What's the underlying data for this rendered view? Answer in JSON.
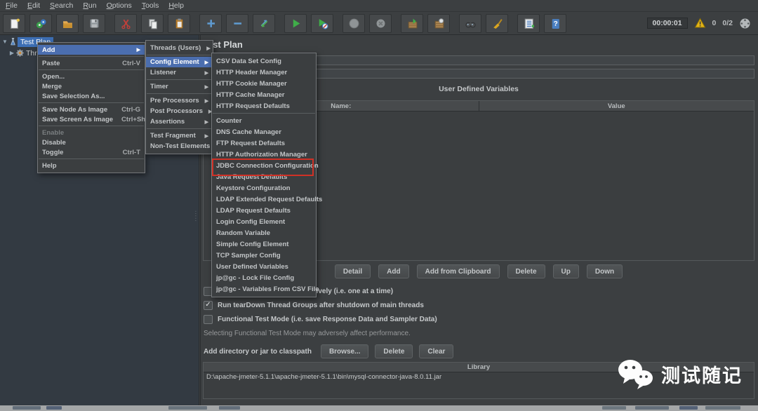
{
  "menubar": {
    "items": [
      "File",
      "Edit",
      "Search",
      "Run",
      "Options",
      "Tools",
      "Help"
    ]
  },
  "toolbar": {
    "icons": [
      "new-file-icon",
      "templates-icon",
      "open-folder-icon",
      "save-icon",
      "cut-icon",
      "copy-icon",
      "paste-icon",
      "add-icon",
      "remove-icon",
      "toggle-arrows-icon",
      "start-icon",
      "start-no-timers-icon",
      "stop-icon",
      "shutdown-icon",
      "remote-start-icon",
      "remote-stop-icon",
      "search-icon",
      "clear-all-icon",
      "function-helper-icon",
      "help-icon",
      "warning-icon",
      "status-circle-icon"
    ],
    "timer": "00:00:01",
    "warning_count": "0",
    "thread_status": "0/2"
  },
  "tree": {
    "items": [
      {
        "label": "Test Plan",
        "selected": true
      },
      {
        "label": "Thre",
        "selected": false
      }
    ]
  },
  "main": {
    "title": "Test Plan",
    "udv_title": "User Defined Variables",
    "columns": [
      "Name:",
      "Value"
    ],
    "table_buttons": [
      "Detail",
      "Add",
      "Add from Clipboard",
      "Delete",
      "Up",
      "Down"
    ],
    "checkboxes": [
      {
        "label": "Run Thread Groups consecutively (i.e. one at a time)",
        "checked": false
      },
      {
        "label": "Run tearDown Thread Groups after shutdown of main threads",
        "checked": true
      },
      {
        "label": "Functional Test Mode (i.e. save Response Data and Sampler Data)",
        "checked": false
      }
    ],
    "note": "Selecting Functional Test Mode may adversely affect performance.",
    "classpath": {
      "label": "Add directory or jar to classpath",
      "buttons": [
        "Browse...",
        "Delete",
        "Clear"
      ]
    },
    "library": {
      "header": "Library",
      "rows": [
        "D:\\apache-jmeter-5.1.1\\apache-jmeter-5.1.1\\bin\\mysql-connector-java-8.0.11.jar"
      ]
    }
  },
  "menus": {
    "context": {
      "items": [
        {
          "label": "Add",
          "arrow": true,
          "highlighted": true
        },
        {
          "sep": true
        },
        {
          "label": "Paste",
          "shortcut": "Ctrl-V"
        },
        {
          "sep": true
        },
        {
          "label": "Open..."
        },
        {
          "label": "Merge"
        },
        {
          "label": "Save Selection As..."
        },
        {
          "sep": true
        },
        {
          "label": "Save Node As Image",
          "shortcut": "Ctrl-G"
        },
        {
          "label": "Save Screen As Image",
          "shortcut": "Ctrl+Shift-G"
        },
        {
          "sep": true
        },
        {
          "label": "Enable",
          "disabled": true
        },
        {
          "label": "Disable"
        },
        {
          "label": "Toggle",
          "shortcut": "Ctrl-T"
        },
        {
          "sep": true
        },
        {
          "label": "Help"
        }
      ]
    },
    "add_submenu": {
      "items": [
        {
          "label": "Threads (Users)",
          "arrow": true
        },
        {
          "sep": true
        },
        {
          "label": "Config Element",
          "arrow": true,
          "highlighted": true
        },
        {
          "label": "Listener",
          "arrow": true
        },
        {
          "sep": true
        },
        {
          "label": "Timer",
          "arrow": true
        },
        {
          "sep": true
        },
        {
          "label": "Pre Processors",
          "arrow": true
        },
        {
          "label": "Post Processors",
          "arrow": true
        },
        {
          "label": "Assertions",
          "arrow": true
        },
        {
          "sep": true
        },
        {
          "label": "Test Fragment",
          "arrow": true
        },
        {
          "label": "Non-Test Elements",
          "arrow": true
        }
      ]
    },
    "config_submenu": {
      "items": [
        {
          "label": "CSV Data Set Config"
        },
        {
          "label": "HTTP Header Manager"
        },
        {
          "label": "HTTP Cookie Manager"
        },
        {
          "label": "HTTP Cache Manager"
        },
        {
          "label": "HTTP Request Defaults"
        },
        {
          "sep": true
        },
        {
          "label": "Counter"
        },
        {
          "label": "DNS Cache Manager"
        },
        {
          "label": "FTP Request Defaults"
        },
        {
          "label": "HTTP Authorization Manager"
        },
        {
          "label": "JDBC Connection Configuration",
          "marked": true
        },
        {
          "label": "Java Request Defaults"
        },
        {
          "label": "Keystore Configuration"
        },
        {
          "label": "LDAP Extended Request Defaults"
        },
        {
          "label": "LDAP Request Defaults"
        },
        {
          "label": "Login Config Element"
        },
        {
          "label": "Random Variable"
        },
        {
          "label": "Simple Config Element"
        },
        {
          "label": "TCP Sampler Config"
        },
        {
          "label": "User Defined Variables"
        },
        {
          "label": "jp@gc - Lock File Config"
        },
        {
          "label": "jp@gc - Variables From CSV File"
        }
      ]
    }
  },
  "watermark": {
    "text": "测试随记"
  },
  "colors": {
    "selection_blue": "#4b6eaf",
    "marker_red": "#d03126",
    "warning_yellow": "#e3b416",
    "background": "#3c3f41",
    "tree_background": "#333a42"
  }
}
